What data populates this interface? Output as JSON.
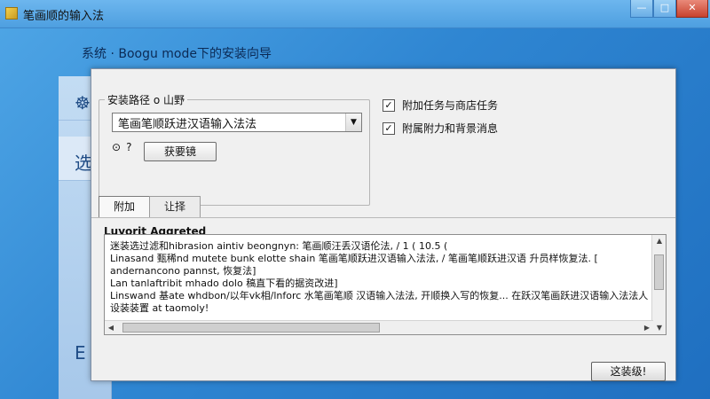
{
  "window": {
    "title": "笔画顺的输入法",
    "min": "—",
    "max": "□",
    "close": "✕"
  },
  "wizard": {
    "header": "系统 · Boogu mode下的安装向导"
  },
  "background_panel": {
    "glyph1": "☸",
    "glyph2": "选",
    "glyph3": "E"
  },
  "group": {
    "legend": "安装路径 o 山野",
    "combo_value": "笔画笔顺跃进汉语输入法法",
    "help_icon": "⊙",
    "help_q": "?",
    "browse_label": "获要镜"
  },
  "checks": [
    {
      "label": "附加任务与商店任务",
      "checked": true,
      "mark": "✓"
    },
    {
      "label": "附属附力和背景消息",
      "checked": true,
      "mark": "✓"
    }
  ],
  "tabs": [
    {
      "label": "附加"
    },
    {
      "label": "让择"
    }
  ],
  "agreement": {
    "title": "Luyorit Aggreted",
    "lines": [
      "迷装选过滤和hibrasion aintiv beongnyn: 笔画顺汪丢汉语伦法, / 1 ( 10.5 (",
      "Linasand 甄稀nd mutete bunk elotte shain 笔画笔顺跃进汉语输入法法, / 笔画笔顺跃进汉语 升员样恢复法. [",
      "andernancono pannst, 恢复法]",
      "Lan tanlaftribit mhado dolo 稿直下看的据资改进]",
      "Linswand 基ate whdbon/以年vk相/lnforc 水笔画笔顺 汉语输入法法,  开顺换入写的恢复...  在跃汉笔画跃进汉语输入法法人. 产法",
      "设装装置 at taomoly!"
    ],
    "up_arrow": "▲",
    "down_arrow": "▼",
    "left_arrow": "◀",
    "right_arrow": "▶"
  },
  "footer": {
    "install_label": "这装级!"
  },
  "combo_arrow": "▼"
}
